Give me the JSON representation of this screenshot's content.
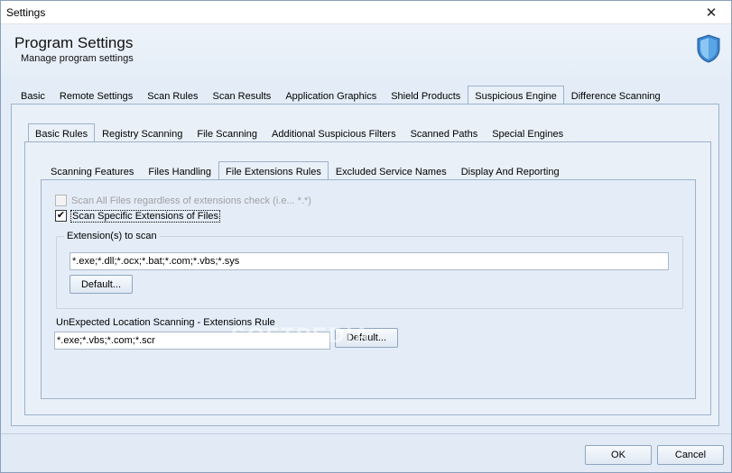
{
  "window": {
    "title": "Settings",
    "close_glyph": "✕"
  },
  "header": {
    "title": "Program Settings",
    "subtitle": "Manage program settings",
    "icon": "shield-icon"
  },
  "main_tabs": [
    {
      "label": "Basic"
    },
    {
      "label": "Remote Settings"
    },
    {
      "label": "Scan Rules"
    },
    {
      "label": "Scan Results"
    },
    {
      "label": "Application Graphics"
    },
    {
      "label": "Shield Products"
    },
    {
      "label": "Suspicious Engine",
      "active": true
    },
    {
      "label": "Difference Scanning"
    }
  ],
  "sub_tabs": [
    {
      "label": "Basic Rules",
      "active": true
    },
    {
      "label": "Registry Scanning"
    },
    {
      "label": "File Scanning"
    },
    {
      "label": "Additional Suspicious Filters"
    },
    {
      "label": "Scanned Paths"
    },
    {
      "label": "Special Engines"
    }
  ],
  "inner_tabs": [
    {
      "label": "Scanning Features"
    },
    {
      "label": "Files Handling"
    },
    {
      "label": "File Extensions Rules",
      "active": true
    },
    {
      "label": "Excluded Service Names"
    },
    {
      "label": "Display And Reporting"
    }
  ],
  "options": {
    "scan_all": {
      "label": "Scan All Files regardless of extensions check (i.e... *.*)",
      "checked": false,
      "disabled": true
    },
    "scan_specific": {
      "label": "Scan Specific Extensions of Files",
      "checked": true,
      "disabled": false
    }
  },
  "extensions_group": {
    "title": "Extension(s) to scan",
    "value": "*.exe;*.dll;*.ocx;*.bat;*.com;*.vbs;*.sys",
    "default_button": "Default..."
  },
  "unexpected": {
    "label": "UnExpected Location Scanning - Extensions Rule",
    "value": "*.exe;*.vbs;*.com;*.scr",
    "default_button": "Default..."
  },
  "watermark": "SOFTPEDIA",
  "footer": {
    "ok": "OK",
    "cancel": "Cancel"
  },
  "checkmark": "✔"
}
